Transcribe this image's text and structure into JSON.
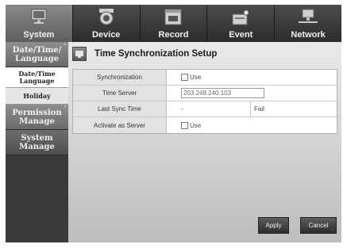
{
  "top_tabs": [
    {
      "label": "System",
      "icon": "monitor-icon",
      "active": true
    },
    {
      "label": "Device",
      "icon": "camera-icon",
      "active": false
    },
    {
      "label": "Record",
      "icon": "rec-icon",
      "active": false
    },
    {
      "label": "Event",
      "icon": "alarm-icon",
      "active": false
    },
    {
      "label": "Network",
      "icon": "network-icon",
      "active": false
    }
  ],
  "sidebar": {
    "date_time_language": "Date/Time/ Language",
    "sub_date_time_language": "Date/Time Language",
    "sub_holiday": "Holiday",
    "permission_manage": "Permission Manage",
    "system_manage": "System Manage"
  },
  "page": {
    "title": "Time Synchronization Setup",
    "icon": "monitor-icon"
  },
  "form": {
    "synchronization_label": "Synchronization",
    "synchronization_use_label": "Use",
    "time_server_label": "Time Server",
    "time_server_value": "203.248.240.103",
    "last_sync_time_label": "Last Sync Time",
    "last_sync_time_value": "-",
    "last_sync_status": "Fail",
    "activate_as_server_label": "Activate as Server",
    "activate_as_server_use_label": "Use"
  },
  "buttons": {
    "apply": "Apply",
    "cancel": "Cancel"
  }
}
